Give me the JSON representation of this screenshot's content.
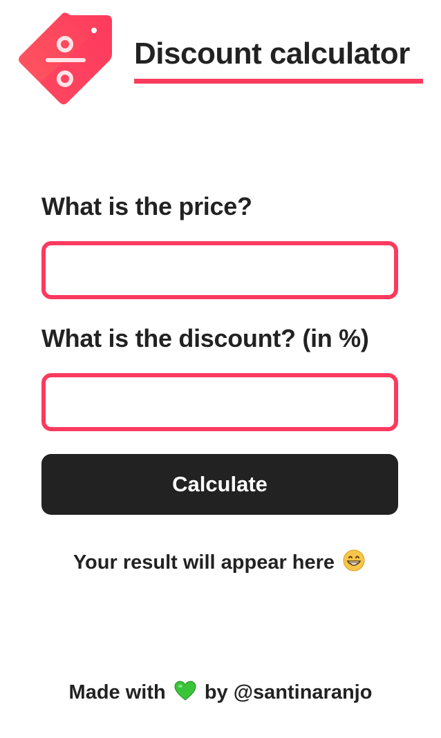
{
  "header": {
    "title": "Discount calculator",
    "logo_icon": "discount-tag-icon",
    "accent_color": "#fc3a5e"
  },
  "form": {
    "price_label": "What is the price?",
    "price_value": "",
    "discount_label": "What is the discount? (in %)",
    "discount_value": "",
    "calculate_label": "Calculate"
  },
  "result": {
    "text": "Your result will appear here",
    "emoji_icon": "grinning-face-icon"
  },
  "footer": {
    "made_with": "Made with",
    "heart_icon": "green-heart-icon",
    "by": "by",
    "author": "@santinaranjo"
  }
}
